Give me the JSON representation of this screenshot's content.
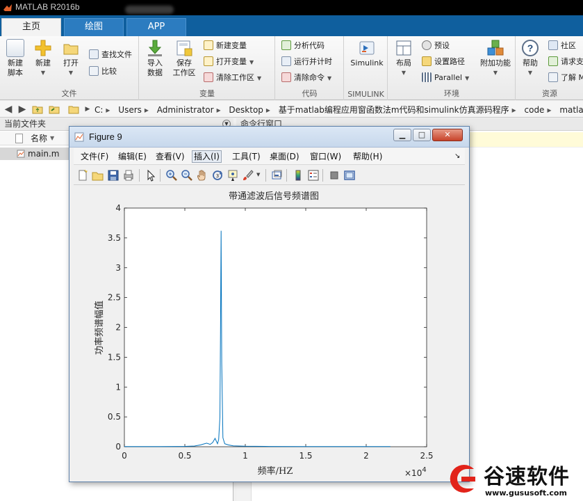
{
  "window": {
    "title": "MATLAB R2016b"
  },
  "tabs": [
    {
      "label": "主页",
      "active": true
    },
    {
      "label": "绘图",
      "active": false
    },
    {
      "label": "APP",
      "active": false
    }
  ],
  "ribbon": {
    "file": {
      "label": "文件",
      "new_script_line1": "新建",
      "new_script_line2": "脚本",
      "new": "新建",
      "open": "打开",
      "find_files": "查找文件",
      "compare": "比较"
    },
    "variable": {
      "label": "变量",
      "import_line1": "导入",
      "import_line2": "数据",
      "save_line1": "保存",
      "save_line2": "工作区",
      "new_variable": "新建变量",
      "open_variable": "打开变量",
      "clear_workspace": "清除工作区"
    },
    "code": {
      "label": "代码",
      "analyze": "分析代码",
      "run_time": "运行并计时",
      "clear_commands": "清除命令"
    },
    "simulink": {
      "label": "SIMULINK",
      "button": "Simulink"
    },
    "environment": {
      "label": "环境",
      "layout": "布局",
      "preferences": "预设",
      "set_path": "设置路径",
      "parallel": "Parallel",
      "addons": "附加功能"
    },
    "resources": {
      "label": "资源",
      "help": "帮助",
      "community": "社区",
      "request_support": "请求支",
      "learn": "了解 M"
    }
  },
  "address": {
    "crumbs": [
      "C:",
      "Users",
      "Administrator",
      "Desktop",
      "基于matlab编程应用窗函数法m代码和simulink仿真源码程序",
      "code",
      "matlab"
    ]
  },
  "left_pane": {
    "title": "当前文件夹",
    "column_name": "名称",
    "files": [
      "main.m"
    ]
  },
  "cmd_pane": {
    "title": "命令行窗口"
  },
  "figure": {
    "title": "Figure 9",
    "menus": [
      "文件(F)",
      "编辑(E)",
      "查看(V)",
      "插入(I)",
      "工具(T)",
      "桌面(D)",
      "窗口(W)",
      "帮助(H)"
    ],
    "active_menu": "插入(I)"
  },
  "chart_data": {
    "type": "line",
    "title": "带通滤波后信号频谱图",
    "xlabel": "频率/HZ",
    "ylabel": "功率频谱幅值",
    "xlim": [
      0,
      25000
    ],
    "ylim": [
      0,
      4
    ],
    "x_exponent_label": "×10",
    "x_exponent_power": "4",
    "x_ticks": [
      0,
      5000,
      10000,
      15000,
      20000,
      25000
    ],
    "x_tick_labels": [
      "0",
      "0.5",
      "1",
      "1.5",
      "2",
      "2.5"
    ],
    "y_ticks": [
      0,
      0.5,
      1,
      1.5,
      2,
      2.5,
      3,
      3.5,
      4
    ],
    "y_tick_labels": [
      "0",
      "0.5",
      "1",
      "1.5",
      "2",
      "2.5",
      "3",
      "3.5",
      "4"
    ],
    "line_color": "#0072BD",
    "series": [
      {
        "x": [
          0,
          3000,
          5000,
          5800,
          6300,
          6800,
          7100,
          7300,
          7500,
          7700,
          7800,
          7900,
          7950,
          8000,
          8050,
          8150,
          8300,
          8600,
          9000,
          10000,
          12000,
          15000,
          18000,
          22000
        ],
        "y": [
          0.003,
          0.004,
          0.006,
          0.012,
          0.03,
          0.06,
          0.04,
          0.07,
          0.14,
          0.05,
          0.12,
          0.5,
          1.9,
          3.62,
          1.4,
          0.15,
          0.05,
          0.03,
          0.015,
          0.008,
          0.005,
          0.004,
          0.003,
          0.002
        ]
      }
    ],
    "grid": false
  },
  "watermark": {
    "text": "谷速软件",
    "url": "www.gususoft.com"
  }
}
